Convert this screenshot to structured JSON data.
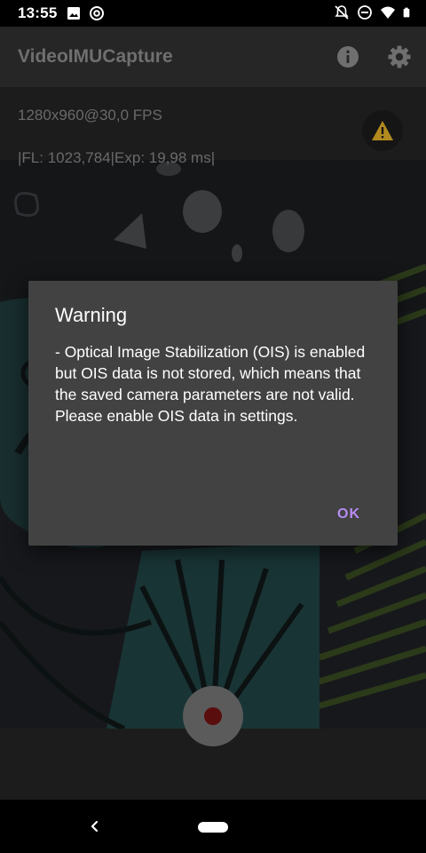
{
  "status_bar": {
    "time": "13:55",
    "left_icons": [
      "image-icon",
      "at-sign-icon"
    ],
    "right_icons": [
      "notifications-off-icon",
      "do-not-disturb-icon",
      "wifi-icon",
      "battery-icon"
    ]
  },
  "app_bar": {
    "title": "VideoIMUCapture",
    "actions": [
      "info-icon",
      "settings-icon"
    ]
  },
  "camera_info": {
    "resolution": "1280x960@30,0 FPS",
    "focal_exposure": "|FL: 1023,784|Exp: 19,98 ms|"
  },
  "dialog": {
    "title": "Warning",
    "message": "- Optical Image Stabilization (OIS) is enabled but OIS data is not stored, which means that the saved camera parameters are not valid. Please enable OIS data in settings.",
    "ok_label": "OK"
  },
  "colors": {
    "accent": "#b78cf5",
    "dialog_bg": "#424242",
    "warning": "#c9a227",
    "record": "#5a0d0d"
  }
}
